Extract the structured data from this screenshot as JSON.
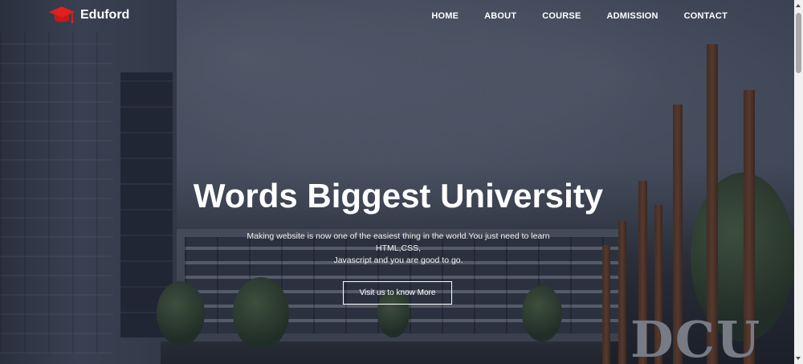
{
  "brand": {
    "name": "Eduford",
    "icon": "graduation-cap-icon",
    "icon_color": "#e02020"
  },
  "nav": {
    "items": [
      {
        "label": "HOME"
      },
      {
        "label": "ABOUT"
      },
      {
        "label": "COURSE"
      },
      {
        "label": "ADMISSION"
      },
      {
        "label": "CONTACT"
      }
    ]
  },
  "hero": {
    "title": "Words Biggest University",
    "description_line1": "Making website is now one of the easiest thing in the world.You just need to learn HTML,CSS,",
    "description_line2": "Javascript and you are good to go.",
    "cta_label": "Visit us to know More",
    "signage_text": "DCU"
  },
  "colors": {
    "text": "#ffffff",
    "overlay": "rgba(20,24,40,0.45)",
    "logo_accent": "#e02020"
  }
}
